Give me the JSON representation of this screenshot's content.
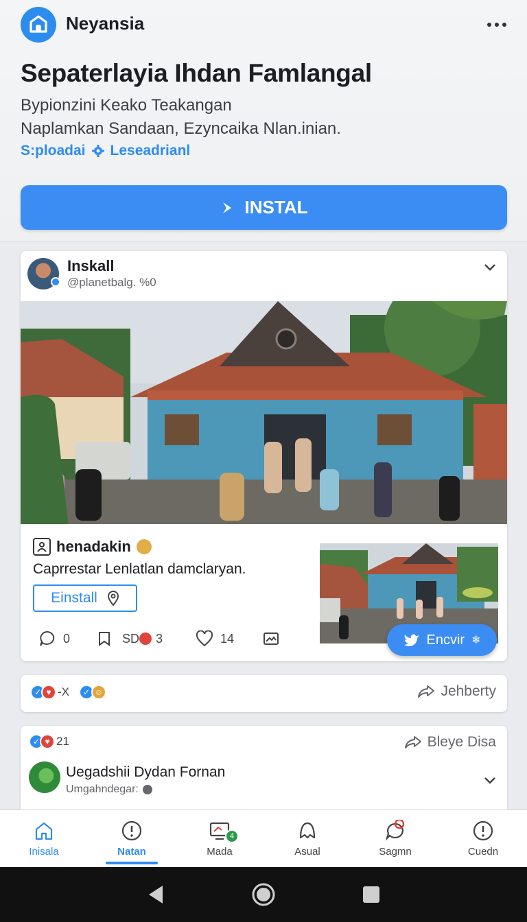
{
  "app": {
    "name": "Neyansia"
  },
  "header": {
    "title": "Sepaterlayia Ihdan Famlangal",
    "subtitle_line1": "Bypionzini Keako Teakangan",
    "subtitle_line2": "Naplamkan Sandaan, Ezyncaika Nlan.inian.",
    "tag1": "S:ploadai",
    "tag2": "Leseadrianl",
    "install_label": "INSTAL"
  },
  "post": {
    "author": "Inskall",
    "handle": "@planetbalg. %0",
    "caption_user": "henadakin",
    "caption": "Caprrestar Lenlatlan damclaryan.",
    "einstall_label": "Einstall",
    "comments": "0",
    "shares_label": "SD",
    "shares_count": "3",
    "likes": "14",
    "encvir_label": "Encvir"
  },
  "strip": {
    "reaction_text": "-X",
    "share_label": "Jehberty"
  },
  "post2": {
    "reaction_count": "21",
    "share_label": "Bleye Disa",
    "author": "Uegadshii Dydan Fornan",
    "handle": "Umgahndegar:"
  },
  "nav": {
    "items": [
      {
        "label": "Inisala"
      },
      {
        "label": "Natan"
      },
      {
        "label": "Mada"
      },
      {
        "label": "Asual"
      },
      {
        "label": "Sagmn"
      },
      {
        "label": "Cuedn"
      }
    ],
    "active_index": 1,
    "mada_badge": "4"
  },
  "colors": {
    "accent": "#2d8cf0",
    "button": "#3b8df3",
    "badge_red": "#e0443a",
    "badge_green": "#2e9a4a"
  },
  "icons": [
    "home-shield-icon",
    "more-icon",
    "arrow-right-icon",
    "chevron-down-icon",
    "comment-icon",
    "bookmark-icon",
    "heart-icon",
    "image-icon",
    "pin-icon",
    "bird-icon",
    "gear-icon",
    "share-arrow-icon"
  ]
}
